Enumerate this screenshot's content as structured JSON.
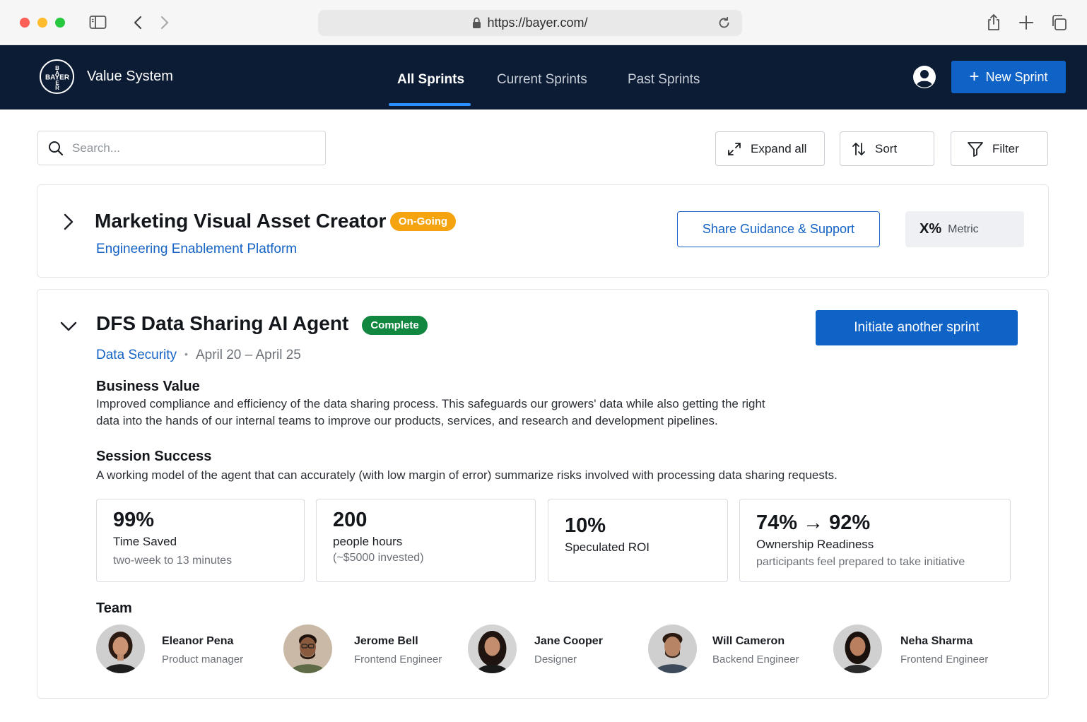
{
  "browser": {
    "url": "https://bayer.com/"
  },
  "header": {
    "logo_text": "BAYER",
    "app_title": "Value System",
    "tabs": [
      {
        "label": "All Sprints",
        "active": true
      },
      {
        "label": "Current Sprints",
        "active": false
      },
      {
        "label": "Past Sprints",
        "active": false
      }
    ],
    "new_sprint_label": "New Sprint"
  },
  "toolbar": {
    "search_placeholder": "Search...",
    "expand_label": "Expand all",
    "sort_label": "Sort",
    "filter_label": "Filter"
  },
  "sprints": [
    {
      "title": "Marketing Visual Asset Creator",
      "status": "On-Going",
      "platform": "Engineering Enablement Platform",
      "guidance_label": "Share Guidance & Support",
      "metric_value": "X%",
      "metric_label": "Metric",
      "expanded": false
    },
    {
      "title": "DFS Data Sharing AI Agent",
      "status": "Complete",
      "category": "Data Security",
      "dates": "April 20 – April 25",
      "initiate_label": "Initiate another sprint",
      "expanded": true,
      "business_value_heading": "Business Value",
      "business_value_line1": "Improved compliance and efficiency of the data sharing process. This safeguards our growers' data while also getting the right",
      "business_value_line2": "data into the hands of our internal teams to improve our products, services, and research and development pipelines.",
      "session_success_heading": "Session Success",
      "session_success_text": "A working model of the agent that can accurately (with low margin of error) summarize risks involved with processing data sharing requests.",
      "stats": [
        {
          "value": "99%",
          "label": "Time Saved",
          "sub": "two-week to 13 minutes"
        },
        {
          "value": "200",
          "label": "people hours",
          "sub": "(~$5000 invested)"
        },
        {
          "value": "10%",
          "label": "Speculated ROI",
          "sub": ""
        },
        {
          "value": "74% → 92%",
          "label": "Ownership Readiness",
          "sub": "participants feel prepared to take initiative"
        }
      ],
      "team_heading": "Team",
      "team": [
        {
          "name": "Eleanor Pena",
          "role": "Product manager"
        },
        {
          "name": "Jerome Bell",
          "role": "Frontend Engineer"
        },
        {
          "name": "Jane Cooper",
          "role": "Designer"
        },
        {
          "name": "Will Cameron",
          "role": "Backend Engineer"
        },
        {
          "name": "Neha Sharma",
          "role": "Frontend Engineer"
        }
      ]
    }
  ],
  "colors": {
    "header_bg": "#0c1c35",
    "primary": "#0f62c6",
    "ongoing": "#f5a30f",
    "complete": "#11873f"
  }
}
